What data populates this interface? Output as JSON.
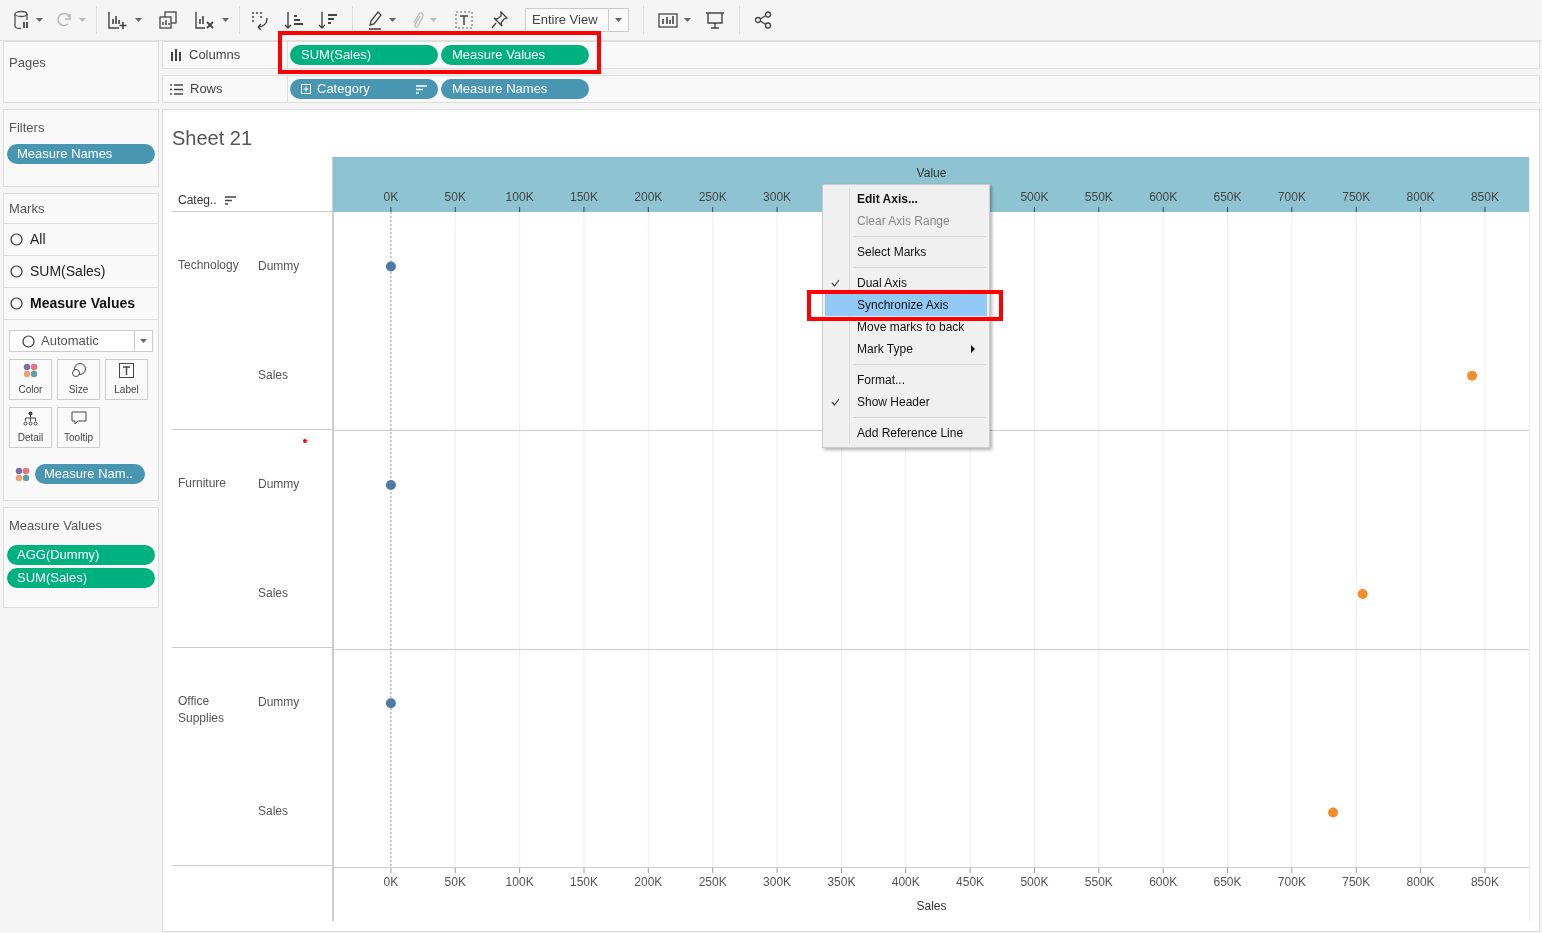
{
  "toolbar": {
    "view_dropdown": "Entire View"
  },
  "pages": {
    "title": "Pages"
  },
  "shelves": [
    {
      "kind": "columns",
      "label": "Columns",
      "pills": [
        {
          "label": "SUM(Sales)",
          "color": "#00b180",
          "sort": false,
          "expand": false
        },
        {
          "label": "Measure Values",
          "color": "#00b180",
          "sort": false,
          "expand": false
        }
      ]
    },
    {
      "kind": "rows",
      "label": "Rows",
      "pills": [
        {
          "label": "Category",
          "color": "#4996b2",
          "sort": true,
          "expand": true
        },
        {
          "label": "Measure Names",
          "color": "#4996b2",
          "sort": false,
          "expand": false
        }
      ]
    }
  ],
  "filters": {
    "title": "Filters",
    "pills": [
      "Measure Names"
    ]
  },
  "marks": {
    "title": "Marks",
    "tabs": [
      {
        "label": "All",
        "selected": false
      },
      {
        "label": "SUM(Sales)",
        "selected": false
      },
      {
        "label": "Measure Values",
        "selected": true
      }
    ],
    "mark_type": "Automatic",
    "buttons": [
      {
        "kind": "color",
        "label": "Color"
      },
      {
        "kind": "size",
        "label": "Size"
      },
      {
        "kind": "label",
        "label": "Label"
      },
      {
        "kind": "detail",
        "label": "Detail"
      },
      {
        "kind": "tooltip",
        "label": "Tooltip"
      }
    ],
    "color_pill": "Measure Nam.."
  },
  "measure_values": {
    "title": "Measure Values",
    "pills": [
      "AGG(Dummy)",
      "SUM(Sales)"
    ]
  },
  "sheet": {
    "title": "Sheet 21",
    "row_header": "Categ..",
    "rows": [
      {
        "category": "Technology",
        "measures": [
          "Dummy",
          "Sales"
        ]
      },
      {
        "category": "Furniture",
        "measures": [
          "Dummy",
          "Sales"
        ]
      },
      {
        "category": "Office Supplies",
        "measures": [
          "Dummy",
          "Sales"
        ]
      }
    ],
    "top_axis": {
      "title": "Value",
      "ticks_left": [
        "0K",
        "50K",
        "100K",
        "150K",
        "200K",
        "250K",
        "300K"
      ],
      "ticks_right": [
        "500K",
        "550K",
        "600K",
        "650K",
        "700K",
        "750K",
        "800K",
        "850K"
      ]
    },
    "chart_data": {
      "type": "scatter",
      "xlabel": "Sales",
      "orientation": "horizontal",
      "grid": true,
      "series": [
        {
          "color": "#4e79a7",
          "values": [
            0,
            null,
            0,
            null,
            0,
            null
          ]
        },
        {
          "color": "#f28e2b",
          "values": [
            null,
            840000,
            null,
            755000,
            null,
            732000
          ]
        }
      ],
      "xlim": [
        -45000,
        885000
      ],
      "ref_lines": [
        {
          "axis": "x",
          "value": 0
        }
      ],
      "xticks": [
        {
          "value": 0,
          "label": "0K"
        },
        {
          "value": 50000,
          "label": "50K"
        },
        {
          "value": 100000,
          "label": "100K"
        },
        {
          "value": 150000,
          "label": "150K"
        },
        {
          "value": 200000,
          "label": "200K"
        },
        {
          "value": 250000,
          "label": "250K"
        },
        {
          "value": 300000,
          "label": "300K"
        },
        {
          "value": 350000,
          "label": "350K"
        },
        {
          "value": 400000,
          "label": "400K"
        },
        {
          "value": 450000,
          "label": "450K"
        },
        {
          "value": 500000,
          "label": "500K"
        },
        {
          "value": 550000,
          "label": "550K"
        },
        {
          "value": 600000,
          "label": "600K"
        },
        {
          "value": 650000,
          "label": "650K"
        },
        {
          "value": 700000,
          "label": "700K"
        },
        {
          "value": 750000,
          "label": "750K"
        },
        {
          "value": 800000,
          "label": "800K"
        },
        {
          "value": 850000,
          "label": "850K"
        }
      ]
    }
  },
  "context_menu": {
    "items": [
      {
        "kind": "item",
        "label": "Edit Axis...",
        "default": true,
        "disabled": false,
        "checked": false,
        "selected": false,
        "submenu": false
      },
      {
        "kind": "item",
        "label": "Clear Axis Range",
        "default": false,
        "disabled": true,
        "checked": false,
        "selected": false,
        "submenu": false
      },
      {
        "kind": "separator"
      },
      {
        "kind": "item",
        "label": "Select Marks",
        "default": false,
        "disabled": false,
        "checked": false,
        "selected": false,
        "submenu": false
      },
      {
        "kind": "separator"
      },
      {
        "kind": "item",
        "label": "Dual Axis",
        "default": false,
        "disabled": false,
        "checked": true,
        "selected": false,
        "submenu": false
      },
      {
        "kind": "item",
        "label": "Synchronize Axis",
        "default": false,
        "disabled": false,
        "checked": false,
        "selected": true,
        "submenu": false
      },
      {
        "kind": "item",
        "label": "Move marks to back",
        "default": false,
        "disabled": false,
        "checked": false,
        "selected": false,
        "submenu": false
      },
      {
        "kind": "item",
        "label": "Mark Type",
        "default": false,
        "disabled": false,
        "checked": false,
        "selected": false,
        "submenu": true
      },
      {
        "kind": "separator"
      },
      {
        "kind": "item",
        "label": "Format...",
        "default": false,
        "disabled": false,
        "checked": false,
        "selected": false,
        "submenu": false
      },
      {
        "kind": "item",
        "label": "Show Header",
        "default": false,
        "disabled": false,
        "checked": true,
        "selected": false,
        "submenu": false
      },
      {
        "kind": "separator"
      },
      {
        "kind": "item",
        "label": "Add Reference Line",
        "default": false,
        "disabled": false,
        "checked": false,
        "selected": false,
        "submenu": false
      }
    ]
  }
}
